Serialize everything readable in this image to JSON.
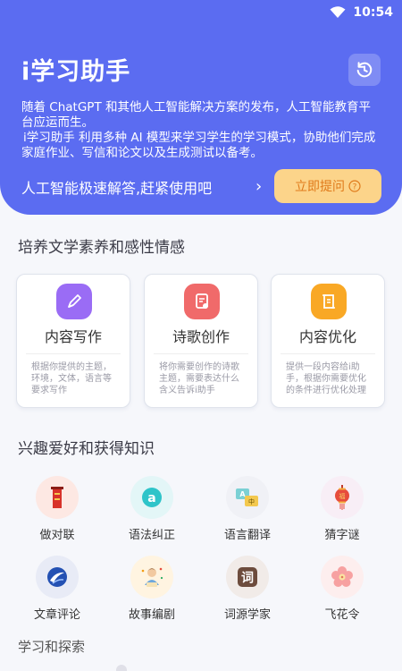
{
  "status_bar": {
    "time": "10:54"
  },
  "header": {
    "title": "i学习助手",
    "intro_p1": "随着 ChatGPT 和其他人工智能解决方案的发布，人工智能教育平台应运而生。",
    "intro_p2": "i学习助手 利用多种 AI 模型来学习学生的学习模式，协助他们完成家庭作业、写信和论文以及生成测试以备考。",
    "slogan": "人工智能极速解答,赶紧使用吧",
    "ask_button": "立即提问"
  },
  "section1": {
    "title": "培养文学素养和感性情感",
    "cards": [
      {
        "title": "内容写作",
        "desc": "根据你提供的主题，环境，文体，语言等要求写作",
        "icon": "pen-icon",
        "color": "#9a6cf5"
      },
      {
        "title": "诗歌创作",
        "desc": "将你需要创作的诗歌主题，需要表达什么含义告诉i助手",
        "icon": "poem-doc-icon",
        "color": "#f06a6a"
      },
      {
        "title": "内容优化",
        "desc": "提供一段内容给i助手，根据你需要优化的条件进行优化处理",
        "icon": "scroll-icon",
        "color": "#f9a825"
      }
    ]
  },
  "section2": {
    "title": "兴趣爱好和获得知识",
    "items": [
      {
        "label": "做对联",
        "icon": "couplet-icon",
        "bg": "#fde8e3"
      },
      {
        "label": "语法纠正",
        "icon": "grammar-icon",
        "bg": "#e3f6f7"
      },
      {
        "label": "语言翻译",
        "icon": "translate-icon",
        "bg": "#f0f1f6"
      },
      {
        "label": "猜字谜",
        "icon": "lantern-icon",
        "bg": "#f8eef6"
      },
      {
        "label": "文章评论",
        "icon": "comment-icon",
        "bg": "#e8ebf6"
      },
      {
        "label": "故事编剧",
        "icon": "story-icon",
        "bg": "#fff4e1"
      },
      {
        "label": "词源学家",
        "icon": "word-icon",
        "bg": "#f1ebe8"
      },
      {
        "label": "飞花令",
        "icon": "flower-icon",
        "bg": "#fdeeee"
      }
    ]
  },
  "section3": {
    "title": "学习和探索"
  }
}
